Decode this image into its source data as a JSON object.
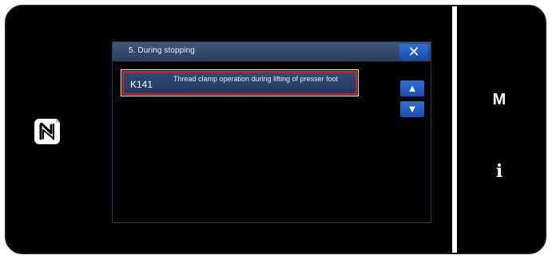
{
  "dialog": {
    "title": "5. During stopping",
    "close_label": "✕"
  },
  "list": {
    "items": [
      {
        "code": "K141",
        "description": "Thread clamp operation during lifting of presser foot",
        "selected": true
      }
    ]
  },
  "scroll": {
    "up_label": "▲",
    "down_label": "▼"
  },
  "side_panel": {
    "menu_key": "M",
    "info_key": "i"
  },
  "icons": {
    "nfc": "nfc-icon"
  },
  "colors": {
    "header": "#3f5678",
    "button": "#2d6fd6",
    "selection_border": "#e02020"
  }
}
